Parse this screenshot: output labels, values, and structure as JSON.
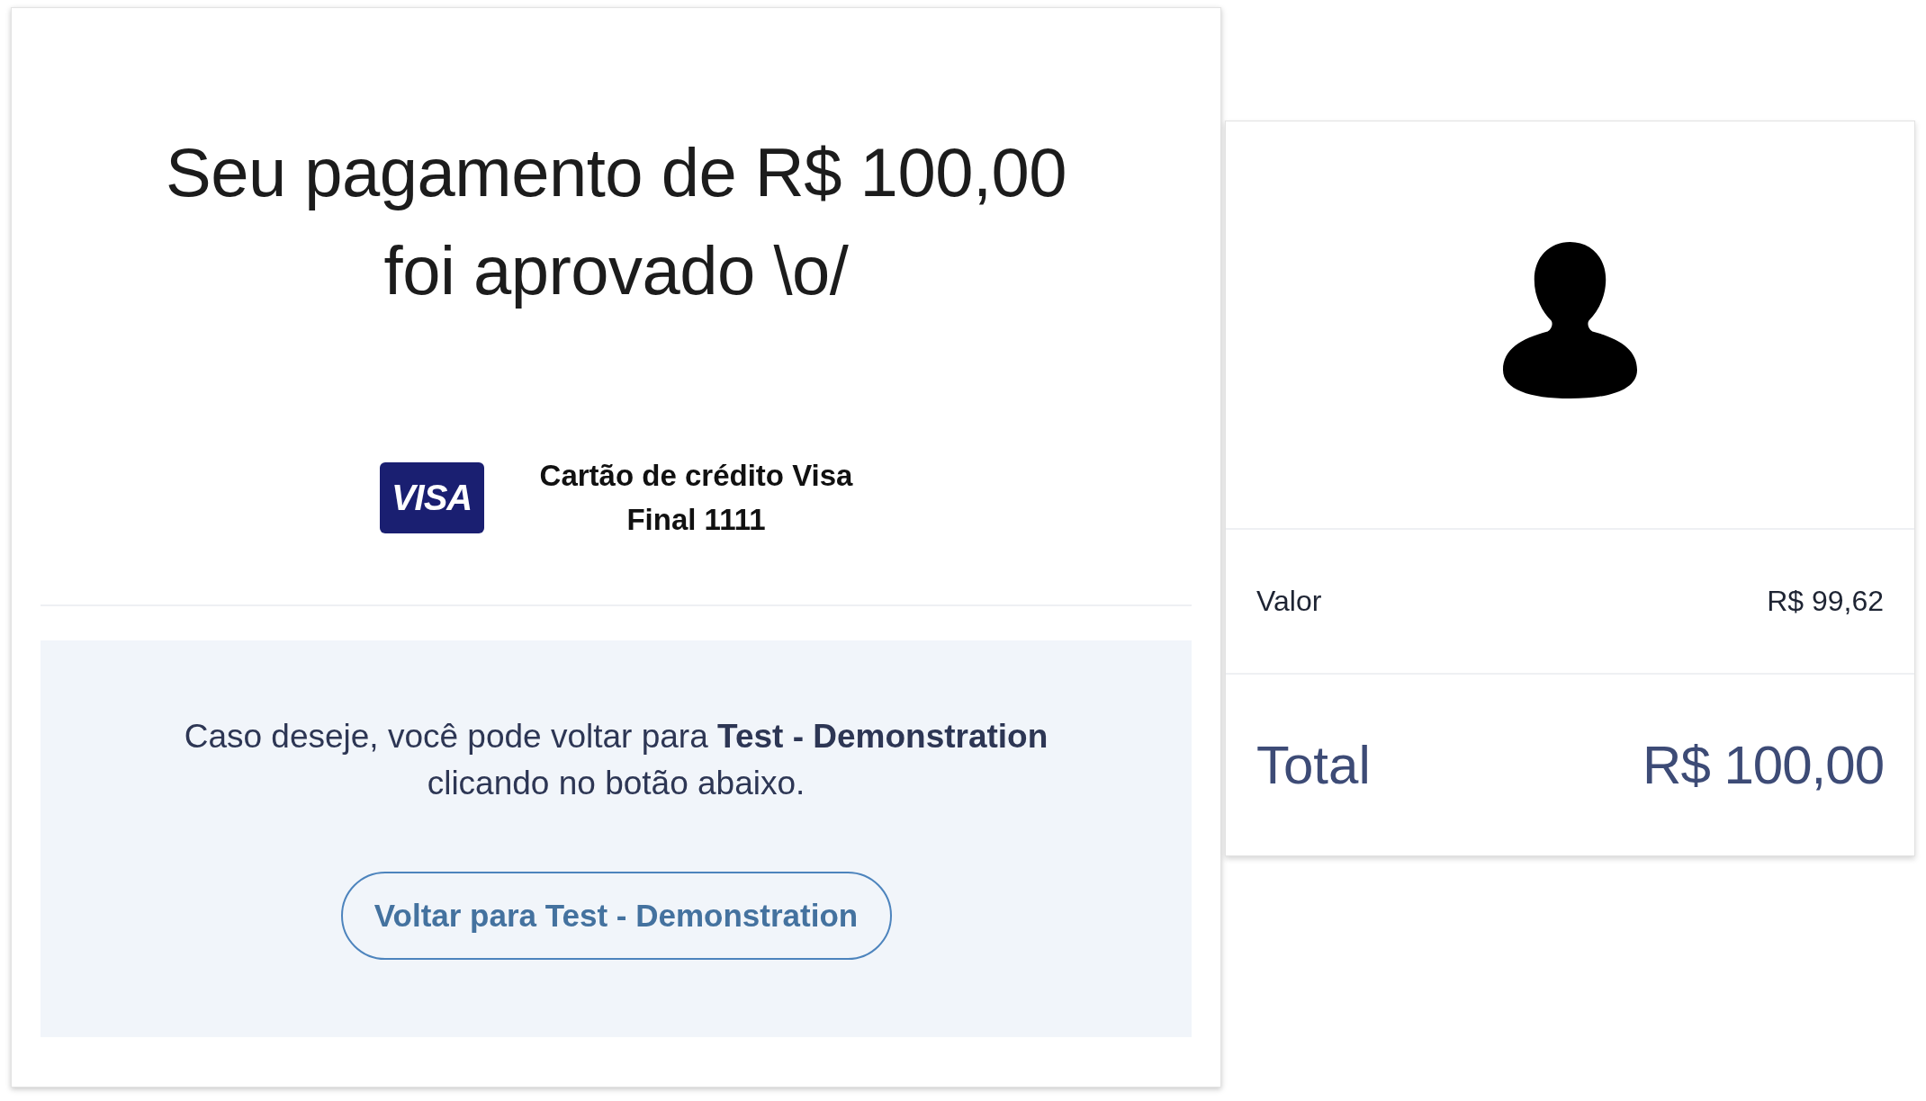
{
  "payment_status": {
    "title": "Seu pagamento de R$ 100,00 foi aprovado \\o/"
  },
  "payment_method": {
    "brand": "VISA",
    "label": "Cartão de crédito Visa",
    "ending": "Final 1111"
  },
  "return_panel": {
    "message": "Caso deseje, você pode voltar para **Test - Demonstration** clicando no botão abaixo.",
    "button": "Voltar para Test - Demonstration"
  },
  "summary": {
    "rows": [
      {
        "kind": "line",
        "label": "Valor",
        "value": "R$ 99,62"
      },
      {
        "kind": "total",
        "label": "Total",
        "value": "R$ 100,00"
      }
    ]
  }
}
